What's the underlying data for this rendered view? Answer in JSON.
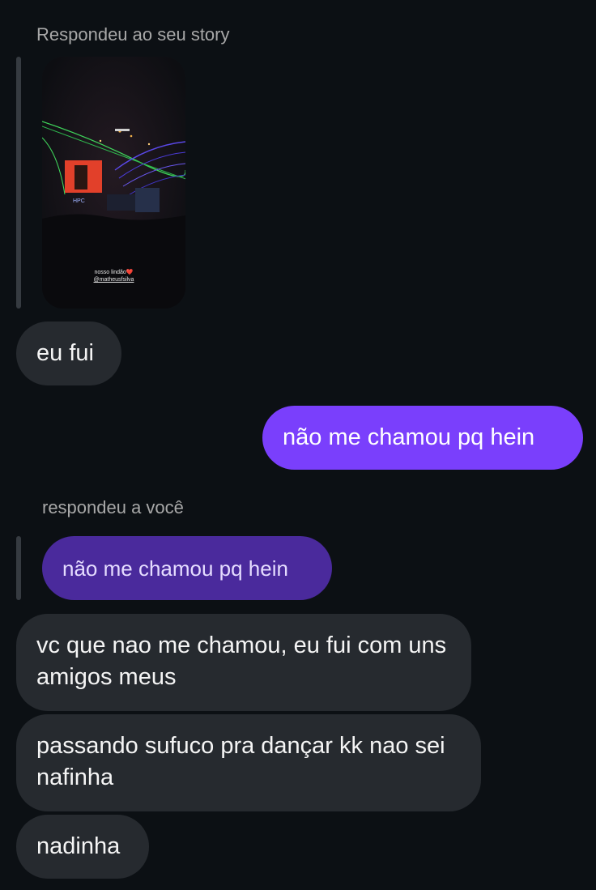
{
  "story_reply": {
    "label": "Respondeu ao seu story",
    "caption": "nosso lindão",
    "caption_emoji": "❤️",
    "handle": "@matheusfsilva",
    "screen_text": "HPC"
  },
  "messages": {
    "m1": "eu fui",
    "m2": "não me chamou pq hein",
    "reply_label": "respondeu a você",
    "quoted": "não me chamou pq hein",
    "m3": "vc que nao me chamou, eu fui com uns amigos meus",
    "m4": "passando sufuco pra dançar kk nao sei nafinha",
    "m5": "nadinha"
  },
  "colors": {
    "background": "#0c1014",
    "incoming_bubble": "#262a2f",
    "outgoing_bubble": "#7a3ffc",
    "quoted_bubble": "#4a2a9c"
  }
}
